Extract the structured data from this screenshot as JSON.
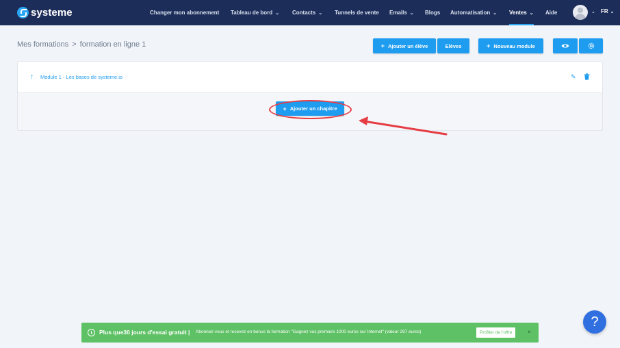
{
  "brand": {
    "name": "systeme",
    "color": "#1d2d5a",
    "accent": "#1e9cf0"
  },
  "nav": {
    "items": [
      {
        "label": "Changer mon abonnement",
        "dropdown": false
      },
      {
        "label": "Tableau de bord",
        "dropdown": true
      },
      {
        "label": "Contacts",
        "dropdown": true
      },
      {
        "label": "Tunnels de vente",
        "dropdown": false
      },
      {
        "label": "Emails",
        "dropdown": true
      },
      {
        "label": "Blogs",
        "dropdown": false
      },
      {
        "label": "Automatisation",
        "dropdown": true
      },
      {
        "label": "Ventes",
        "dropdown": true,
        "active": true
      },
      {
        "label": "Aide",
        "dropdown": false
      }
    ],
    "language": "FR"
  },
  "breadcrumb": {
    "parent": "Mes formations",
    "separator": ">",
    "current": "formation en ligne 1"
  },
  "actions": {
    "add_student": "Ajouter un élève",
    "students": "Elèves",
    "new_module": "Nouveau module",
    "preview_icon": "eye-icon",
    "settings_icon": "gear-icon"
  },
  "module": {
    "title": "Module 1 - Les bases de systeme.io",
    "add_chapter": "Ajouter un chapitre",
    "icons": {
      "expand": "arrow-up-icon",
      "edit": "pencil-icon",
      "delete": "trash-icon"
    }
  },
  "annotation": {
    "highlight_color": "#e63c44"
  },
  "banner": {
    "strong": "Plus que30 jours d'essai gratuit |",
    "text": "Abonnez-vous et recevez en bonus la formation \"Gagnez vos premiers 1000 euros sur Internet\" (valeur 297 euros)",
    "cta": "Profiter de l'offre",
    "close": "×",
    "color": "#5fc166"
  },
  "help": {
    "label": "?"
  }
}
